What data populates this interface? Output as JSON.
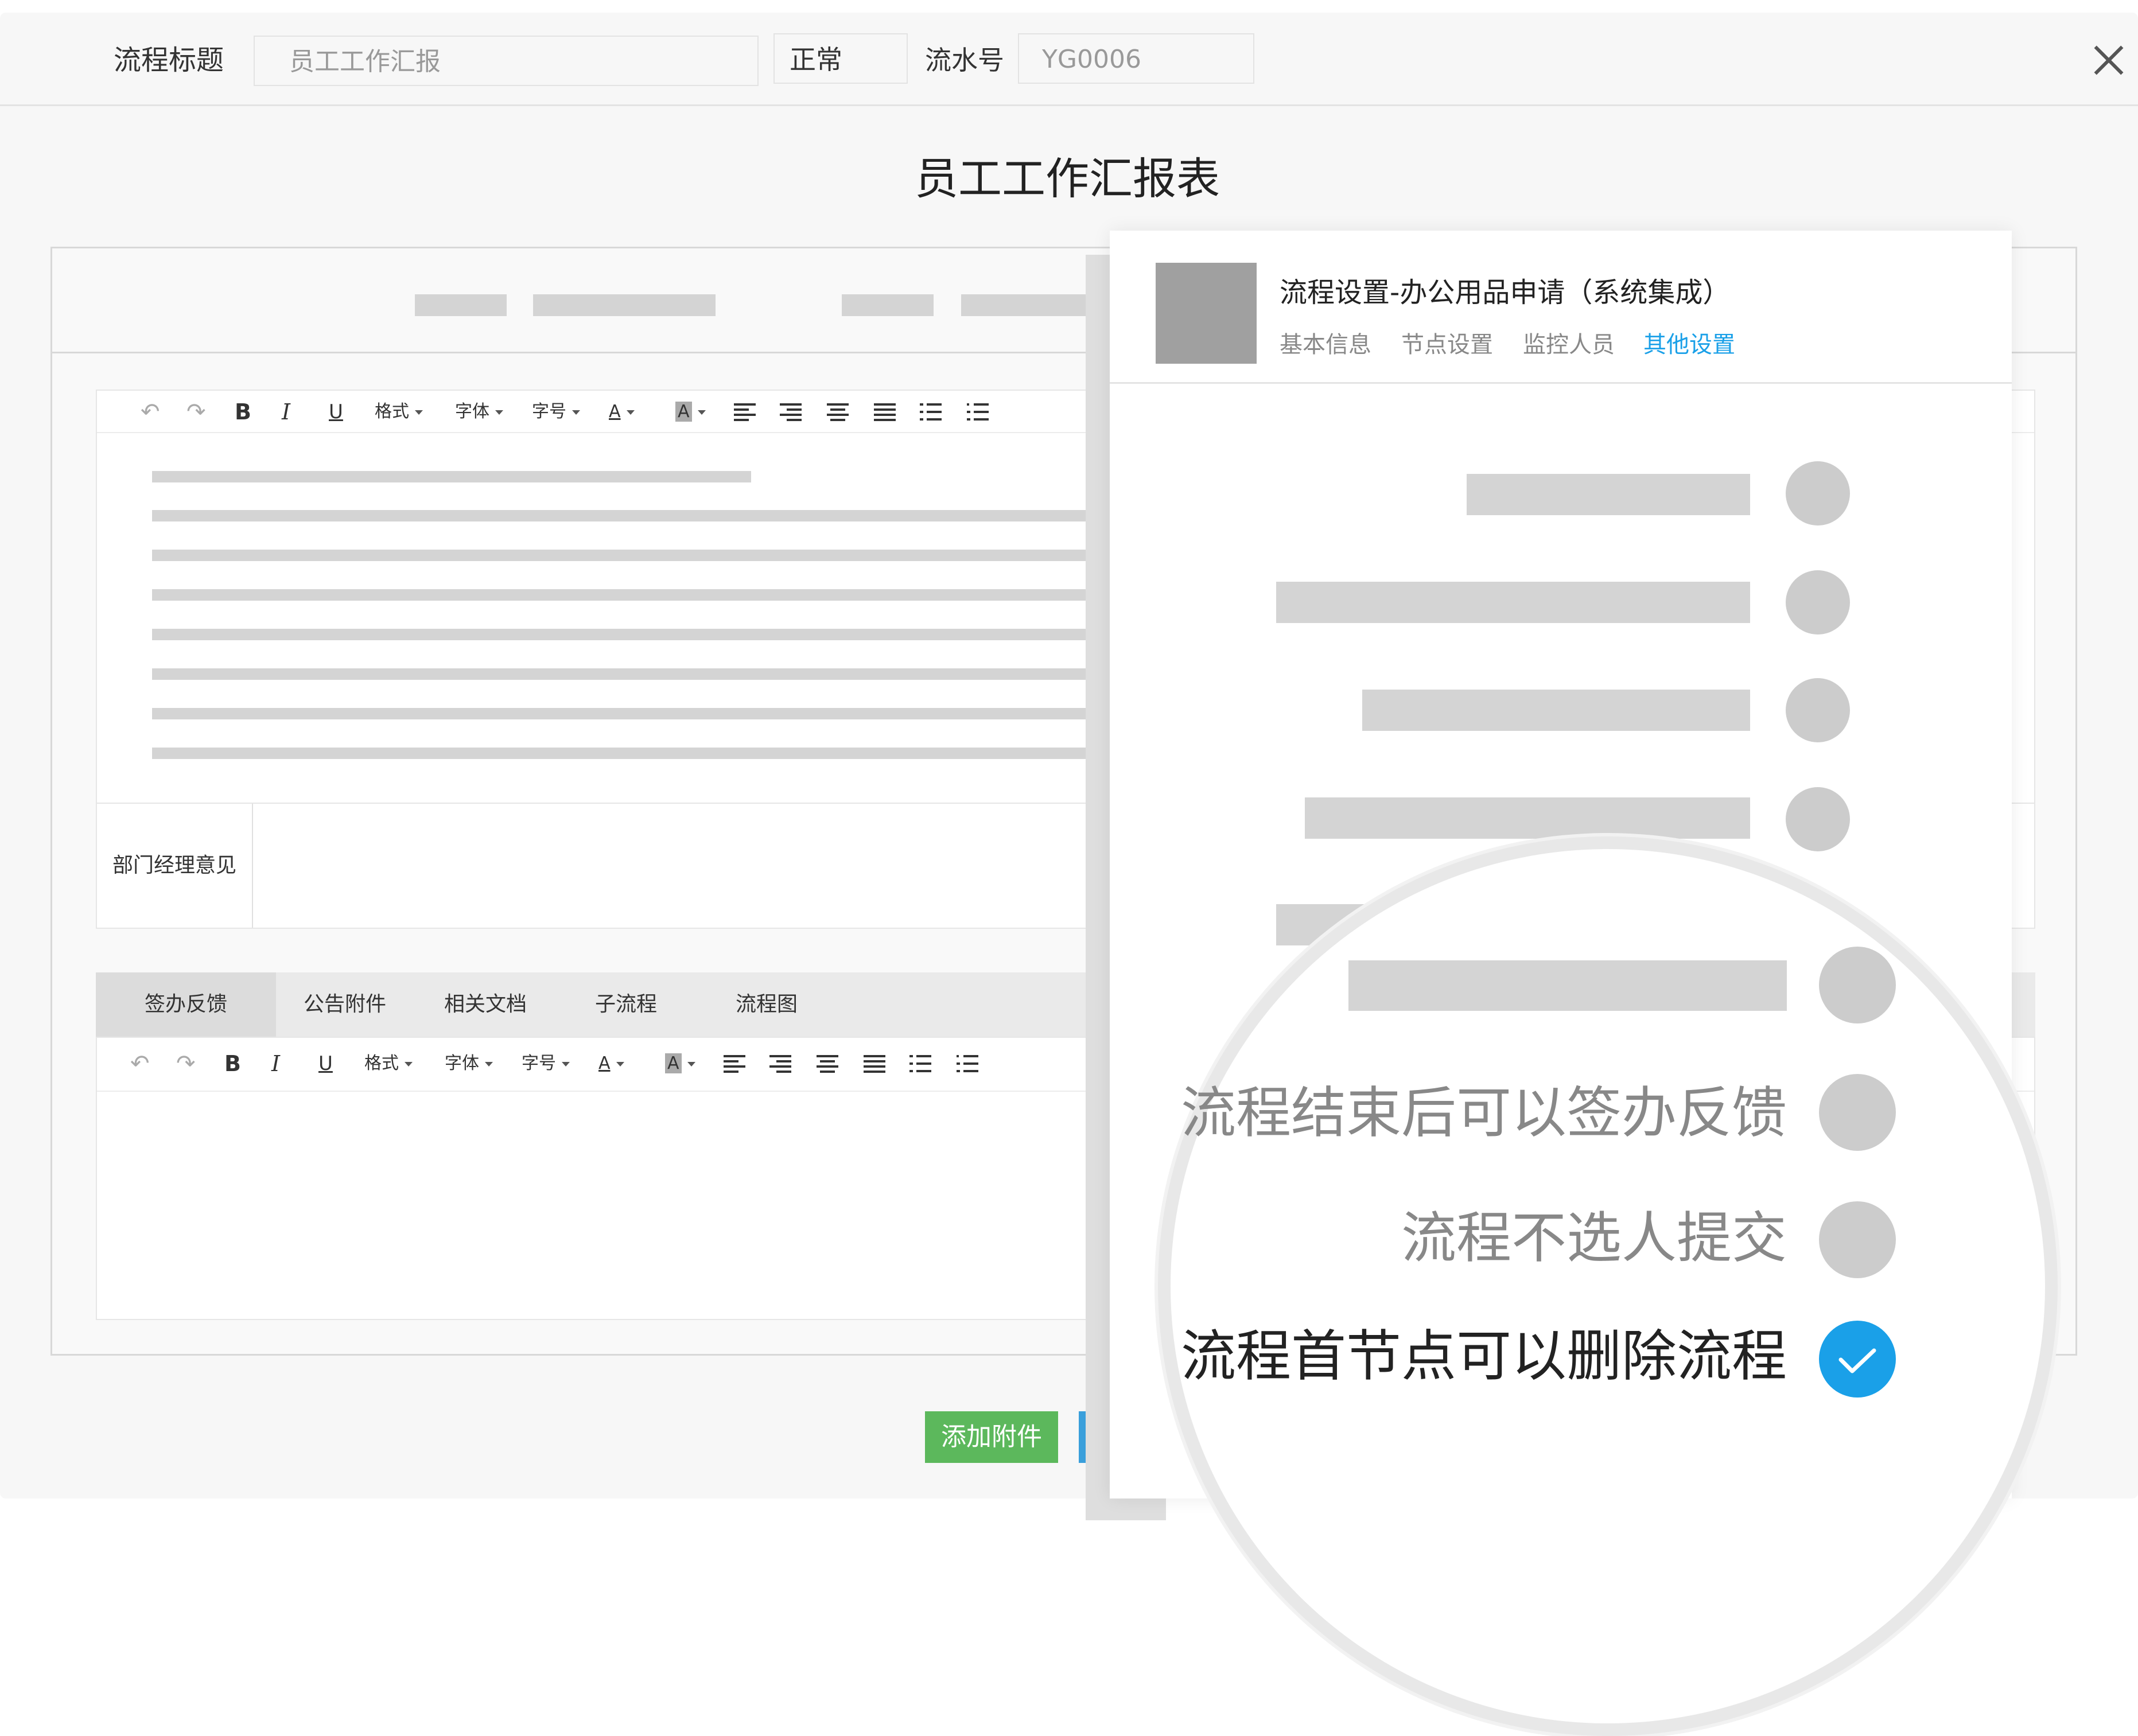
{
  "header": {
    "title_label": "流程标题",
    "title_value": "员工工作汇报",
    "priority_value": "正常",
    "serial_label": "流水号",
    "serial_value": "YG0006"
  },
  "form": {
    "title": "员工工作汇报表",
    "opinion_label": "部门经理意见"
  },
  "toolbar": {
    "format": "格式",
    "font": "字体",
    "size": "字号",
    "bold": "B",
    "italic": "I",
    "underline": "U",
    "font_color": "A",
    "bg_color": "A"
  },
  "tabs": [
    "签办反馈",
    "公告附件",
    "相关文档",
    "子流程",
    "流程图"
  ],
  "buttons": {
    "add_attachment": "添加附件"
  },
  "panel": {
    "title": "流程设置-办公用品申请（系统集成）",
    "tabs": [
      {
        "label": "基本信息",
        "active": false
      },
      {
        "label": "节点设置",
        "active": false
      },
      {
        "label": "监控人员",
        "active": false
      },
      {
        "label": "其他设置",
        "active": true
      }
    ],
    "options": [
      {
        "label": "流程结束后可以签办反馈",
        "checked": false
      },
      {
        "label": "流程不选人提交",
        "checked": false
      },
      {
        "label": "流程首节点可以删除流程",
        "checked": true
      }
    ]
  },
  "colors": {
    "accent": "#1aa0e8",
    "green": "#5cb85c",
    "placeholder_gray": "#d4d4d4"
  }
}
